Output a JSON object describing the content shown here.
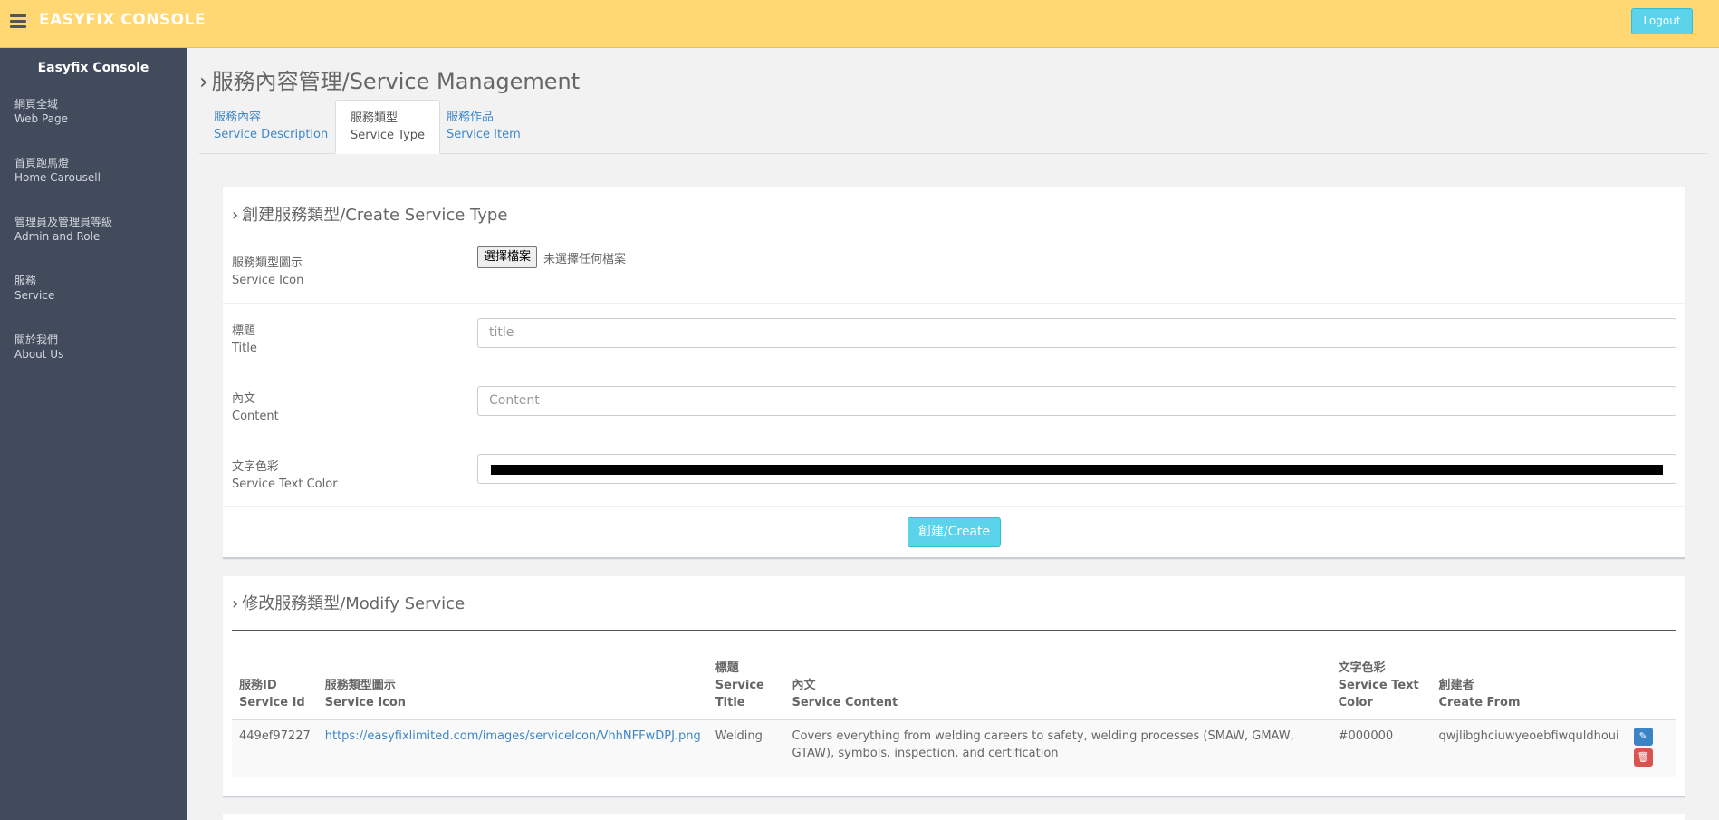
{
  "topbar": {
    "brand": "EASYFIX CONSOLE",
    "logout_label": "Logout"
  },
  "sidebar": {
    "title": "Easyfix Console",
    "items": [
      {
        "zh": "網頁全域",
        "en": "Web Page"
      },
      {
        "zh": "首頁跑馬燈",
        "en": "Home Carousell"
      },
      {
        "zh": "管理員及管理員等級",
        "en": "Admin and Role"
      },
      {
        "zh": "服務",
        "en": "Service"
      },
      {
        "zh": "關於我們",
        "en": "About Us"
      }
    ]
  },
  "page": {
    "title": "服務內容管理/Service Management"
  },
  "tabs": [
    {
      "zh": "服務內容",
      "en": "Service Description"
    },
    {
      "zh": "服務類型",
      "en": "Service Type"
    },
    {
      "zh": "服務作品",
      "en": "Service Item"
    }
  ],
  "create_form": {
    "heading": "創建服務類型/Create Service Type",
    "icon_label_zh": "服務類型圖示",
    "icon_label_en": "Service Icon",
    "file_button": "選擇檔案",
    "file_status": "未選擇任何檔案",
    "title_label_zh": "標題",
    "title_label_en": "Title",
    "title_placeholder": "title",
    "content_label_zh": "內文",
    "content_label_en": "Content",
    "content_placeholder": "Content",
    "color_label_zh": "文字色彩",
    "color_label_en": "Service Text Color",
    "color_value": "#000000",
    "create_label": "創建/Create"
  },
  "modify": {
    "heading": "修改服務類型/Modify Service",
    "columns": [
      {
        "l1": "服務ID",
        "l2": "Service Id",
        "l3": ""
      },
      {
        "l1": "服務類型圖示",
        "l2": "Service Icon",
        "l3": ""
      },
      {
        "l1": "標題",
        "l2": "Service",
        "l3": "Title"
      },
      {
        "l1": "內文",
        "l2": "Service Content",
        "l3": ""
      },
      {
        "l1": "文字色彩",
        "l2": "Service Text",
        "l3": "Color"
      },
      {
        "l1": "創建者",
        "l2": "Create From",
        "l3": ""
      }
    ],
    "rows": [
      {
        "id": "449ef97227",
        "icon_url": "https://easyfixlimited.com/images/serviceIcon/VhhNFFwDPJ.png",
        "title": "Welding",
        "content": "Covers everything from welding careers to safety, welding processes (SMAW, GMAW, GTAW), symbols, inspection, and certification",
        "color": "#000000",
        "creator": "qwjlibghciuwyeoebfiwquldhoui"
      }
    ]
  },
  "colors": {
    "topbar": "#ffd773",
    "sidebar": "#414b5c",
    "accent": "#5bd3ea",
    "link": "#3f87c7",
    "danger": "#d9534f"
  },
  "icons": {
    "menu": "hamburger-icon",
    "chevron": "chevron-right-icon",
    "edit": "pencil-icon",
    "delete": "trash-icon"
  }
}
